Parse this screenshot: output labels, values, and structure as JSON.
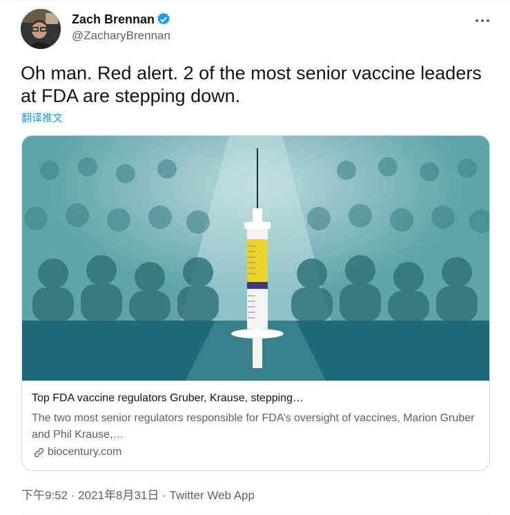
{
  "author": {
    "name": "Zach Brennan",
    "handle": "@ZacharyBrennan"
  },
  "icons": {
    "verified": "verified-badge-icon",
    "more": "more-options-icon",
    "link": "link-icon"
  },
  "tweet": {
    "text": "Oh man. Red alert. 2 of the most senior vaccine leaders at FDA are stepping down.",
    "translate_label": "翻译推文"
  },
  "card": {
    "title": "Top FDA vaccine regulators Gruber, Krause, stepping…",
    "description": "The two most senior regulators responsible for FDA’s oversight of vaccines, Marion Gruber and Phil Krause,…",
    "domain": "biocentury.com"
  },
  "meta": {
    "time": "下午9:52",
    "date": "2021年8月31日",
    "separator": " · ",
    "source": "Twitter Web App"
  },
  "colors": {
    "accent": "#1d9bf0",
    "teal": "#3f8f9a"
  }
}
